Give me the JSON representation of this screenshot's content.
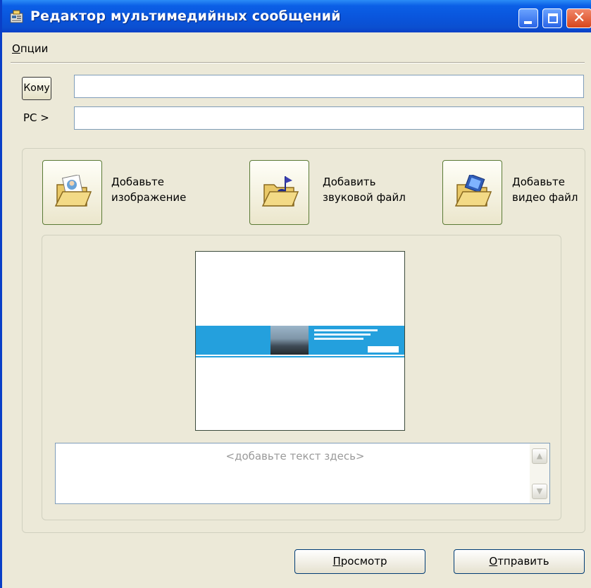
{
  "window": {
    "title": "Редактор мультимедийных сообщений"
  },
  "menu": {
    "options_ul": "О",
    "options_rest": "пции"
  },
  "recipients": {
    "to_button": "Кому",
    "to_value": "",
    "cc_label": "РС >",
    "cc_value": ""
  },
  "attachments": {
    "add_image_line1": "Добавьте",
    "add_image_line2": "изображение",
    "add_sound_line1": "Добавить",
    "add_sound_line2": "звуковой файл",
    "add_video_line1": "Добавьте",
    "add_video_line2": "видео файл"
  },
  "message": {
    "placeholder": "<добавьте текст здесь>"
  },
  "buttons": {
    "preview_ul": "П",
    "preview_rest": "росмотр",
    "send_ul": "О",
    "send_rest": "тправить"
  },
  "icons": {
    "title": "mms-editor-icon",
    "image": "folder-image-icon",
    "sound": "folder-music-icon",
    "video": "folder-video-icon"
  },
  "colors": {
    "titlebar": "#0a55dc",
    "window_bg": "#ece9d8",
    "close_button": "#d8461b",
    "banner": "#24a0dd"
  }
}
